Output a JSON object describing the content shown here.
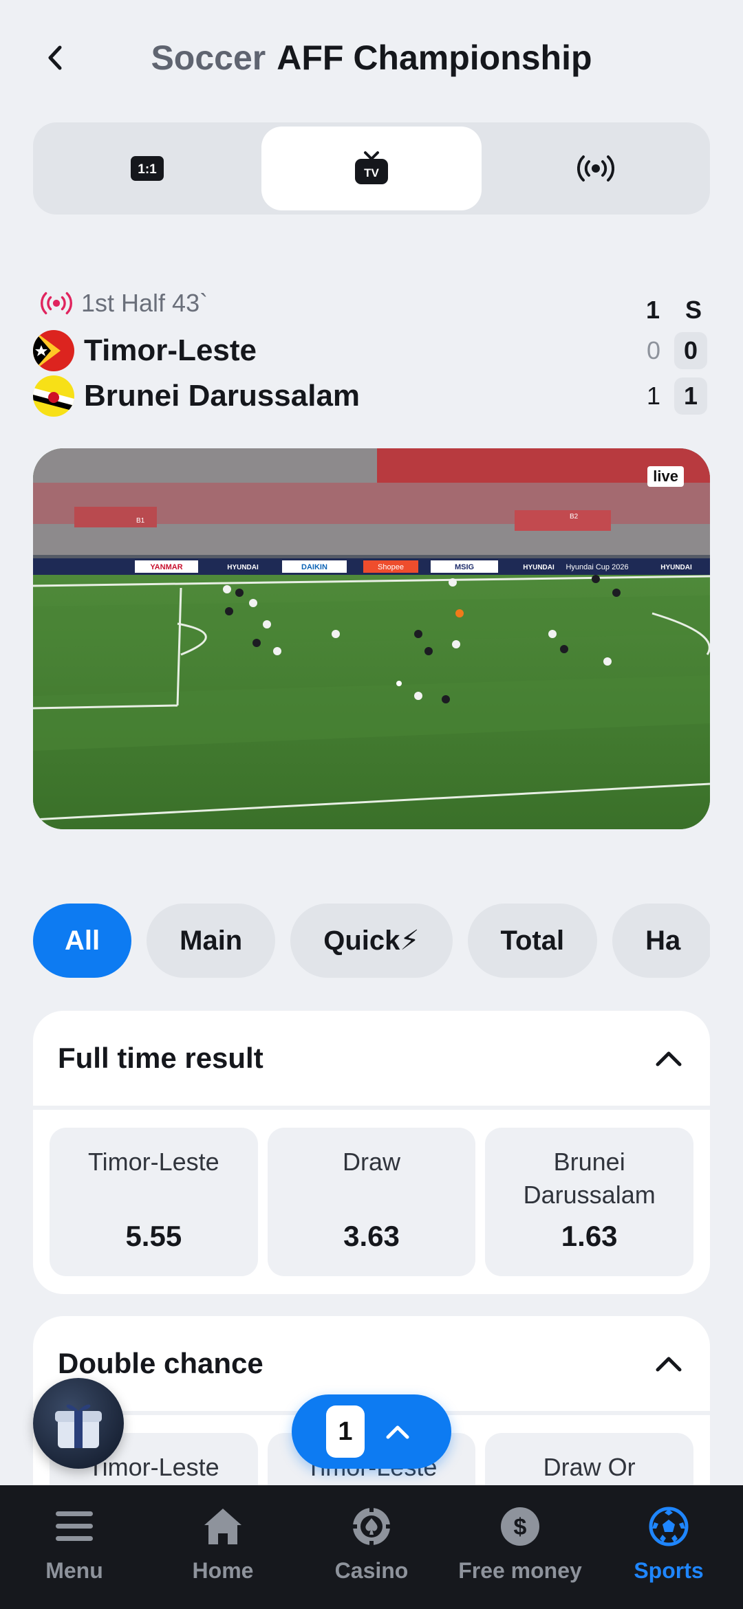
{
  "header": {
    "sport": "Soccer",
    "league": "AFF Championship",
    "back_icon": "chevron-left-icon"
  },
  "segments": [
    {
      "icon": "one-vs-one-icon",
      "label": "1:1",
      "active": false
    },
    {
      "icon": "tv-icon",
      "label": "TV",
      "active": true
    },
    {
      "icon": "live-broadcast-icon",
      "active": false
    }
  ],
  "match": {
    "status": "1st Half 43`",
    "col_first": "1",
    "col_total": "S",
    "teams": [
      {
        "name": "Timor-Leste",
        "first_half": "0",
        "total": "0"
      },
      {
        "name": "Brunei Darussalam",
        "first_half": "1",
        "total": "1"
      }
    ]
  },
  "video": {
    "badge": "live",
    "ads": [
      "YANMAR",
      "HYUNDAI",
      "DAIKIN",
      "Shopee",
      "MSIG",
      "HYUNDAI",
      "Hyundai Cup 2026",
      "HYUNDAI"
    ],
    "stand_labels": [
      "B1",
      "B2"
    ]
  },
  "filters": [
    "All",
    "Main",
    "Quick⚡",
    "Total",
    "Ha"
  ],
  "markets": [
    {
      "title": "Full time result",
      "odds": [
        {
          "label": "Timor-Leste",
          "value": "5.55"
        },
        {
          "label": "Draw",
          "value": "3.63"
        },
        {
          "label": "Brunei Darussalam",
          "value": "1.63"
        }
      ]
    },
    {
      "title": "Double chance",
      "odds": [
        {
          "label": "Timor-Leste",
          "value": ""
        },
        {
          "label": "Timor-Leste",
          "value": ""
        },
        {
          "label": "Draw Or",
          "value": ""
        }
      ]
    }
  ],
  "betslip": {
    "count": "1"
  },
  "tabbar": [
    {
      "label": "Menu",
      "icon": "menu-icon",
      "active": false
    },
    {
      "label": "Home",
      "icon": "home-icon",
      "active": false
    },
    {
      "label": "Casino",
      "icon": "casino-chip-icon",
      "active": false
    },
    {
      "label": "Free money",
      "icon": "dollar-icon",
      "active": false
    },
    {
      "label": "Sports",
      "icon": "soccer-ball-icon",
      "active": true
    }
  ],
  "colors": {
    "accent": "#0d7bf2",
    "live": "#e0245e",
    "tabbar_bg": "#16181d"
  }
}
